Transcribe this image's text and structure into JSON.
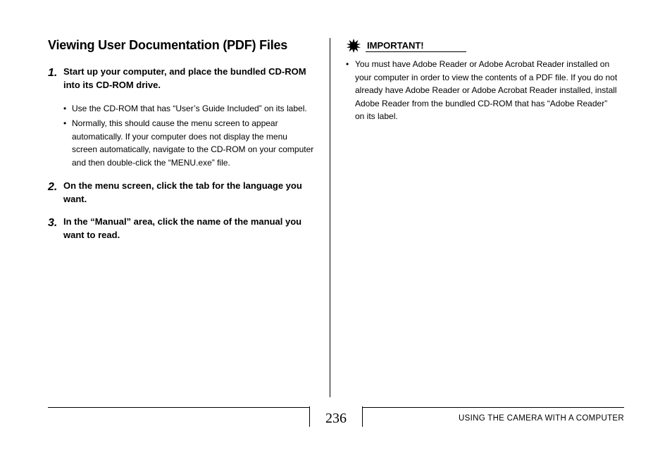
{
  "title": "Viewing User Documentation (PDF) Files",
  "steps": [
    {
      "num": "1.",
      "text": "Start up your computer, and place the bundled CD-ROM into its CD-ROM drive.",
      "bullets": [
        "Use the CD-ROM that has “User’s Guide Included” on its label.",
        "Normally, this should cause the menu screen to appear automatically. If your computer does not display the menu screen automatically, navigate to the CD-ROM on your computer and then double-click the “MENU.exe” file."
      ]
    },
    {
      "num": "2.",
      "text": "On the menu screen, click the tab for the language you want.",
      "bullets": []
    },
    {
      "num": "3.",
      "text": "In the “Manual” area, click the name of the manual you want to read.",
      "bullets": []
    }
  ],
  "important": {
    "label": "IMPORTANT!",
    "bullets": [
      "You must have Adobe Reader or Adobe Acrobat Reader installed on your computer in order to view the contents of a PDF file. If you do not already have Adobe Reader or Adobe Acrobat Reader installed, install Adobe Reader from the bundled CD-ROM that has “Adobe Reader” on its label."
    ]
  },
  "footer": {
    "page_number": "236",
    "section": "USING THE CAMERA WITH A COMPUTER"
  }
}
